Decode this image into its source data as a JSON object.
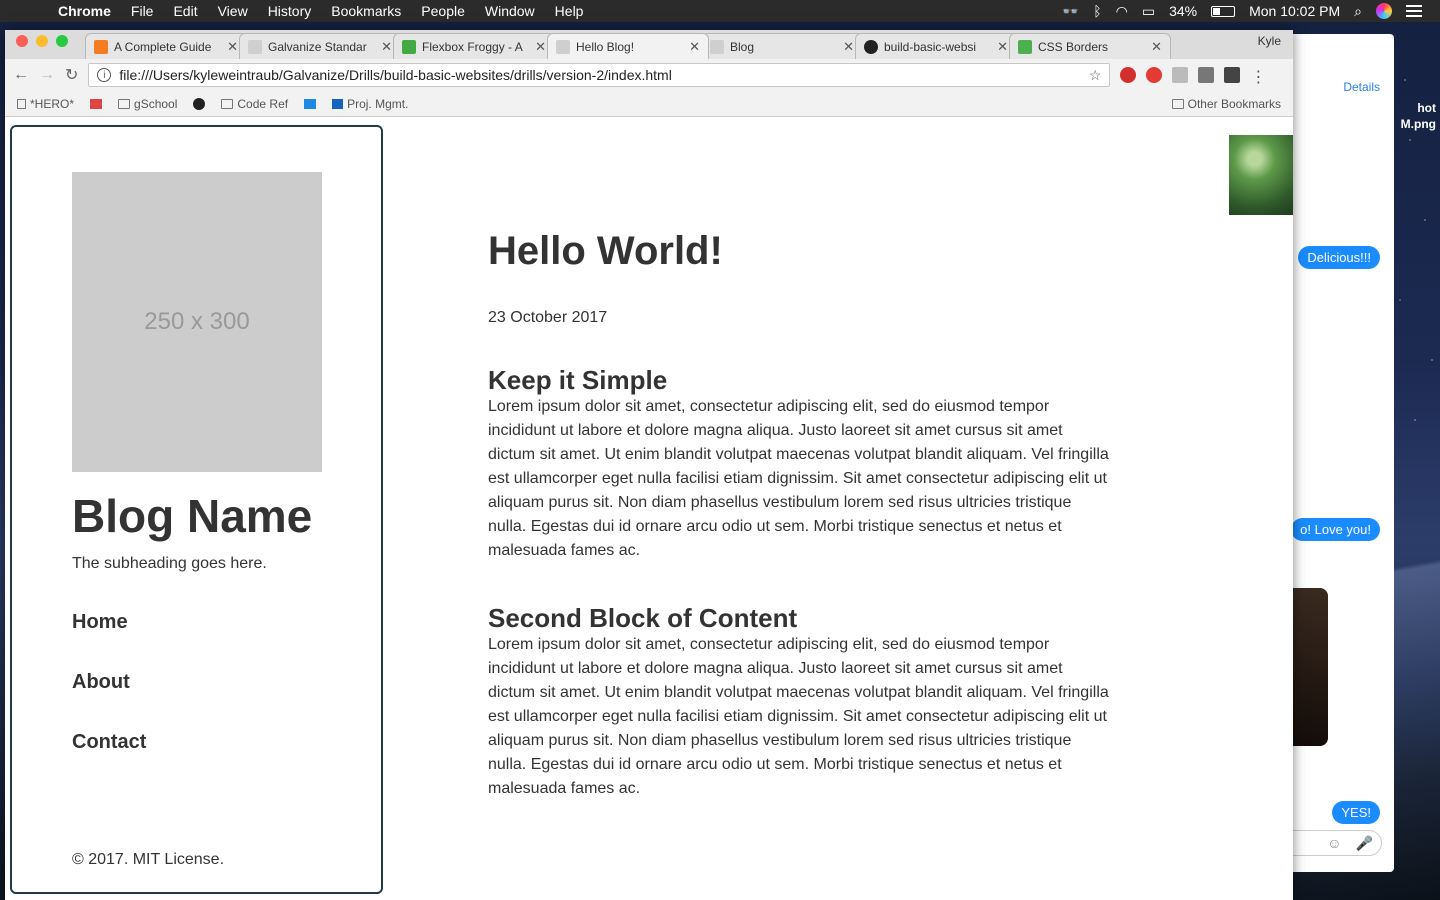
{
  "menubar": {
    "app": "Chrome",
    "items": [
      "File",
      "Edit",
      "View",
      "History",
      "Bookmarks",
      "People",
      "Window",
      "Help"
    ],
    "battery": "34%",
    "clock": "Mon 10:02 PM"
  },
  "desktop": {
    "file_label_1": "hot",
    "file_label_2": "M.png"
  },
  "messages": {
    "details": "Details",
    "bubbles": [
      "Delicious!!!",
      "o! Love you!",
      "YES!"
    ]
  },
  "browser": {
    "profile": "Kyle",
    "tabs": [
      {
        "title": "A Complete Guide",
        "favicon_color": "#f57c20"
      },
      {
        "title": "Galvanize Standar",
        "favicon_color": "#cfcfcf"
      },
      {
        "title": "Flexbox Froggy - A",
        "favicon_color": "#44aa44"
      },
      {
        "title": "Hello Blog!",
        "favicon_color": "#cfcfcf"
      },
      {
        "title": "Blog",
        "favicon_color": "#cfcfcf"
      },
      {
        "title": "build-basic-websi",
        "favicon_color": "#222222"
      },
      {
        "title": "CSS Borders",
        "favicon_color": "#4caf50"
      }
    ],
    "url": "file:///Users/kyleweintraub/Galvanize/Drills/build-basic-websites/drills/version-2/index.html",
    "bookmarks": [
      "*HERO*",
      "",
      "gSchool",
      "",
      "Code Ref",
      "",
      "Proj. Mgmt."
    ],
    "other_bookmarks": "Other Bookmarks"
  },
  "page": {
    "placeholder": "250 x 300",
    "blog_name": "Blog Name",
    "subheading": "The subheading goes here.",
    "nav": [
      "Home",
      "About",
      "Contact"
    ],
    "footer": "© 2017. MIT License.",
    "post": {
      "title": "Hello World!",
      "date": "23 October 2017",
      "sections": [
        {
          "heading": "Keep it Simple",
          "body": "Lorem ipsum dolor sit amet, consectetur adipiscing elit, sed do eiusmod tempor incididunt ut labore et dolore magna aliqua. Justo laoreet sit amet cursus sit amet dictum sit amet. Ut enim blandit volutpat maecenas volutpat blandit aliquam. Vel fringilla est ullamcorper eget nulla facilisi etiam dignissim. Sit amet consectetur adipiscing elit ut aliquam purus sit. Non diam phasellus vestibulum lorem sed risus ultricies tristique nulla. Egestas dui id ornare arcu odio ut sem. Morbi tristique senectus et netus et malesuada fames ac."
        },
        {
          "heading": "Second Block of Content",
          "body": "Lorem ipsum dolor sit amet, consectetur adipiscing elit, sed do eiusmod tempor incididunt ut labore et dolore magna aliqua. Justo laoreet sit amet cursus sit amet dictum sit amet. Ut enim blandit volutpat maecenas volutpat blandit aliquam. Vel fringilla est ullamcorper eget nulla facilisi etiam dignissim. Sit amet consectetur adipiscing elit ut aliquam purus sit. Non diam phasellus vestibulum lorem sed risus ultricies tristique nulla. Egestas dui id ornare arcu odio ut sem. Morbi tristique senectus et netus et malesuada fames ac."
        }
      ]
    }
  }
}
